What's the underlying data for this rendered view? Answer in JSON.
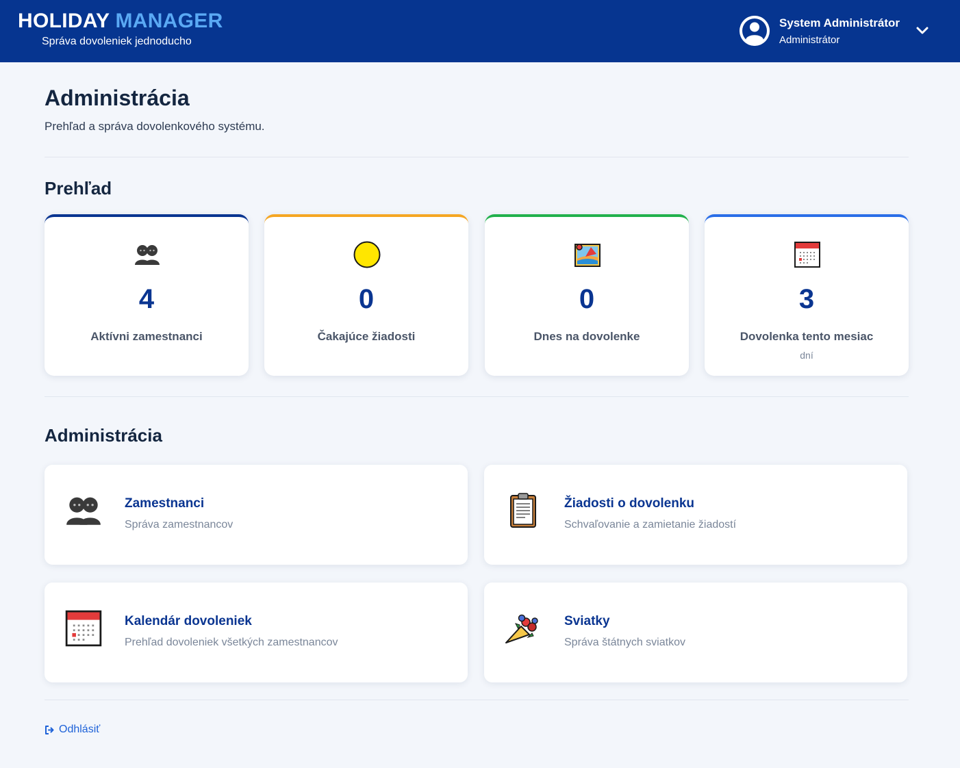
{
  "header": {
    "brand_word1": "HOLIDAY",
    "brand_word2": "MANAGER",
    "tagline": "Správa dovoleniek jednoducho",
    "user_name": "System Administrátor",
    "user_role": "Administrátor",
    "avatar_icon": "user-circle-icon",
    "menu_icon": "chevron-down-icon"
  },
  "page": {
    "title": "Administrácia",
    "description": "Prehľad a správa dovolenkového systému."
  },
  "overview": {
    "title": "Prehľad",
    "cards": [
      {
        "icon": "people-icon",
        "value": "4",
        "label": "Aktívni zamestnanci",
        "sub": "",
        "accent": "#0a3591"
      },
      {
        "icon": "yellow-circle-icon",
        "value": "0",
        "label": "Čakajúce žiadosti",
        "sub": "",
        "accent": "#f5a623"
      },
      {
        "icon": "beach-picture-icon",
        "value": "0",
        "label": "Dnes na dovolenke",
        "sub": "",
        "accent": "#22b14c"
      },
      {
        "icon": "calendar-icon",
        "value": "3",
        "label": "Dovolenka tento mesiac",
        "sub": "dní",
        "accent": "#2a6ee8"
      }
    ]
  },
  "admin": {
    "title": "Administrácia",
    "cards": [
      {
        "icon": "people-icon",
        "title": "Zamestnanci",
        "desc": "Správa zamestnancov"
      },
      {
        "icon": "clipboard-icon",
        "title": "Žiadosti o dovolenku",
        "desc": "Schvaľovanie a zamietanie žiadostí"
      },
      {
        "icon": "calendar-icon",
        "title": "Kalendár dovoleniek",
        "desc": "Prehľad dovoleniek všetkých zamestnancov"
      },
      {
        "icon": "bouquet-icon",
        "title": "Sviatky",
        "desc": "Správa štátnych sviatkov"
      }
    ]
  },
  "footer": {
    "logout_label": "Odhlásiť",
    "logout_icon": "sign-out-icon"
  },
  "colors": {
    "header_bg": "#063590",
    "brand_accent": "#5aa9f4",
    "primary": "#0a3591",
    "link": "#1e62d8",
    "page_bg": "#f3f6fb"
  }
}
